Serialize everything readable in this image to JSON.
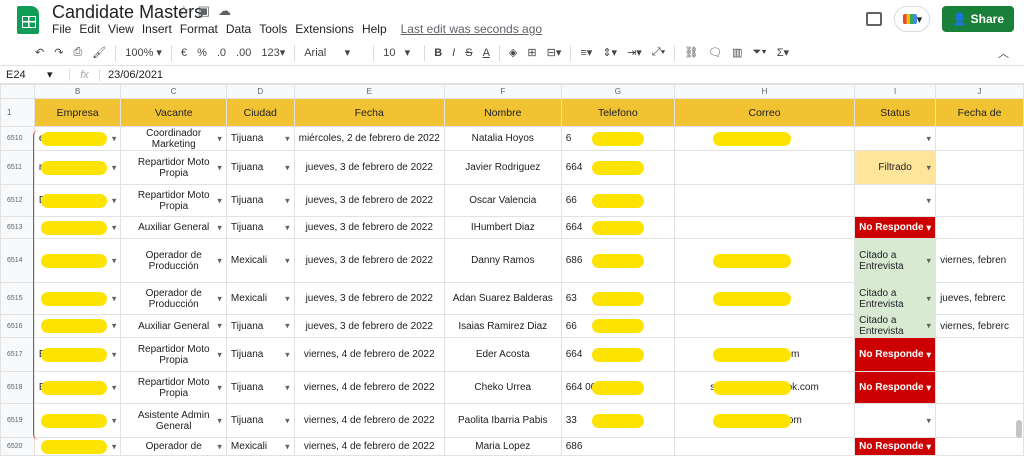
{
  "app": {
    "title": "Candidate Masters",
    "menus": [
      "File",
      "Edit",
      "View",
      "Insert",
      "Format",
      "Data",
      "Tools",
      "Extensions",
      "Help"
    ],
    "last_edit": "Last edit was seconds ago",
    "share": "Share"
  },
  "toolbar": {
    "zoom": "100%",
    "currency": "€",
    "percent": "%",
    "dec_less": ".0",
    "dec_more": ".00",
    "number_format": "123",
    "font": "Arial",
    "font_size": "10",
    "bold": "B",
    "italic": "I",
    "strike": "S",
    "text_color": "A"
  },
  "formula": {
    "cell": "E24",
    "fx": "fx",
    "value": "23/06/2021"
  },
  "columns": [
    "B",
    "C",
    "D",
    "E",
    "F",
    "G",
    "H",
    "I",
    "J"
  ],
  "header": {
    "row": "1",
    "cells": [
      "Empresa",
      "Vacante",
      "Ciudad",
      "Fecha",
      "Nombre",
      "Telefono",
      "Correo",
      "Status",
      "Fecha de"
    ]
  },
  "rows": [
    {
      "n": "6510",
      "empresa": "e",
      "vacante": "Coordinador Marketing",
      "ciudad": "Tijuana",
      "fecha": "miércoles, 2 de febrero de 2022",
      "nombre": "Natalia Hoyos",
      "tel": "6",
      "correo": "na                  ve.com",
      "status": "",
      "j": ""
    },
    {
      "n": "6511",
      "empresa": "rs",
      "vacante": "Repartidor Moto Propia",
      "ciudad": "Tijuana",
      "fecha": "jueves, 3 de febrero de 2022",
      "nombre": "Javier Rodriguez",
      "tel": "664",
      "correo": "",
      "status": "Filtrado",
      "j": ""
    },
    {
      "n": "6512",
      "empresa": "D",
      "vacante": "Repartidor Moto Propia",
      "ciudad": "Tijuana",
      "fecha": "jueves, 3 de febrero de 2022",
      "nombre": "Oscar Valencia",
      "tel": "66",
      "correo": "",
      "status": "",
      "j": ""
    },
    {
      "n": "6513",
      "empresa": "",
      "vacante": "Auxiliar General",
      "ciudad": "Tijuana",
      "fecha": "jueves, 3 de febrero de 2022",
      "nombre": "IHumbert Diaz",
      "tel": "664",
      "correo": "",
      "status": "No Responde",
      "j": ""
    },
    {
      "n": "6514",
      "empresa": "",
      "vacante": "Operador de Producción",
      "ciudad": "Mexicali",
      "fecha": "jueves, 3 de febrero de 2022",
      "nombre": "Danny Ramos",
      "tel": "686",
      "correo": "rafi                    ail.com",
      "status": "Citado a Entrevista",
      "j": "viernes, febren"
    },
    {
      "n": "6515",
      "empresa": "",
      "vacante": "Operador de Producción",
      "ciudad": "Mexicali",
      "fecha": "jueves, 3 de febrero de 2022",
      "nombre": "Adan Suarez Balderas",
      "tel": "63",
      "correo": "pl                       mail.com",
      "status": "Citado a Entrevista",
      "j": "jueves, febrerc"
    },
    {
      "n": "6516",
      "empresa": "",
      "vacante": "Auxiliar General",
      "ciudad": "Tijuana",
      "fecha": "jueves, 3 de febrero de 2022",
      "nombre": "Isaias Ramirez Diaz",
      "tel": "66",
      "correo": "",
      "status": "Citado a Entrevista",
      "j": "viernes, febrerc"
    },
    {
      "n": "6517",
      "empresa": "B",
      "vacante": "Repartidor Moto Propia",
      "ciudad": "Tijuana",
      "fecha": "viernes, 4 de febrero de 2022",
      "nombre": "Eder Acosta",
      "tel": "664",
      "correo": "ed                     @gmail.com",
      "status": "No Responde",
      "j": ""
    },
    {
      "n": "6518",
      "empresa": "Bo",
      "vacante": "Repartidor Moto Propia",
      "ciudad": "Tijuana",
      "fecha": "viernes, 4 de febrero de 2022",
      "nombre": "Cheko Urrea",
      "tel": "664      0091",
      "correo": "serg                  1307@outlook.com",
      "status": "No Responde",
      "j": ""
    },
    {
      "n": "6519",
      "empresa": "",
      "vacante": "Asistente Admin General",
      "ciudad": "Tijuana",
      "fecha": "viernes, 4 de febrero de 2022",
      "nombre": "Paolita Ibarria Pabis",
      "tel": "33",
      "correo": "paolita.ib                   ail.com",
      "status": "",
      "j": ""
    },
    {
      "n": "6520",
      "empresa": "",
      "vacante": "Operador de",
      "ciudad": "Mexicali",
      "fecha": "viernes, 4 de febrero de 2022",
      "nombre": "Maria Lopez",
      "tel": "686",
      "correo": "",
      "status": "No Responde",
      "j": ""
    }
  ],
  "colors": {
    "header": "#f1c232",
    "no_responde": "#cc0000",
    "filtrado": "#ffe599",
    "citado": "#d9ead3",
    "share": "#188038",
    "redaction": "#fde400"
  }
}
